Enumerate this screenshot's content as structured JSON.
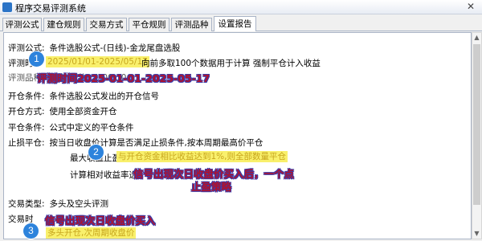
{
  "window": {
    "title": "程序交易评测系统",
    "close": "✕"
  },
  "tabs": [
    {
      "label": "评测公式"
    },
    {
      "label": "建仓规则"
    },
    {
      "label": "交易方式"
    },
    {
      "label": "平仓规则"
    },
    {
      "label": "评测品种"
    },
    {
      "label": "设置报告"
    }
  ],
  "report": {
    "formula": {
      "label": "评测公式:",
      "value": "条件选股公式-(日线)-金龙尾盘选股"
    },
    "period": {
      "label": "评测时",
      "date_range": "2025/01/01-2025/05/17",
      "value_tail": "向前多取100个数据用于计算 强制平仓计入收益"
    },
    "variety": {
      "label": "评测品种:",
      "value": "多空...(共...1:00...0...)"
    },
    "open_cond": {
      "label": "开仓条件:",
      "value": "条件选股公式发出的开仓信号"
    },
    "open_method": {
      "label": "开仓方式:",
      "value": "使用全部资金开仓"
    },
    "close_cond": {
      "label": "平仓条件:",
      "value": "公式中定义的平仓条件"
    },
    "stop": {
      "label": "止损平仓:",
      "line1": "按当日收盘价计算是否满足止损条件,按本周期最高价平仓",
      "line2_prefix": "最大收益止盈:",
      "line2_highlight": "与开仓资金相比收益达到1%,则全部数量平仓",
      "line3": "计算相对收益率选"
    },
    "trade_type": {
      "label": "交易类型:",
      "value": "多头及空头评测"
    },
    "trade_time": {
      "label": "交易时"
    },
    "bottom_highlight": "多头开仓,次周期收盘价"
  },
  "annotations": {
    "c1": "1",
    "c2": "2",
    "c3": "3",
    "note1": "评测时间2025-01-01-2025-05-17",
    "note2a": "信号出现次日收盘价买入后，一个点",
    "note2b": "止盈策略",
    "note3": "信号出现次日收盘价买入"
  }
}
